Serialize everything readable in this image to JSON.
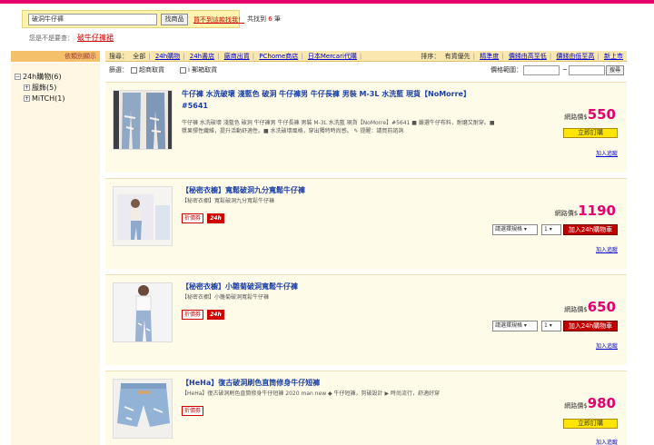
{
  "search": {
    "value": "破洞牛仔褲",
    "button": "找商品",
    "not_found": "買不到這款找我！"
  },
  "result": {
    "prefix": "共找到",
    "count": "6",
    "suffix": "筆"
  },
  "did_you_mean": {
    "label": "您是不是要查：",
    "suggestion": "破牛仔褲裙"
  },
  "sidebar": {
    "header": "依類別顯示",
    "items": [
      {
        "label": "24h購物(6)",
        "toggle": "−"
      },
      {
        "label": "服飾(5)",
        "toggle": "+"
      },
      {
        "label": "MiTCH(1)",
        "toggle": "+"
      }
    ]
  },
  "tabs": {
    "label": "搜尋：",
    "items": [
      "全部",
      "24h購物",
      "24h書店",
      "廠商出貨",
      "PChome商店",
      "日本Mercari代購"
    ]
  },
  "sort": {
    "label": "排序：",
    "items": [
      "有貨優先",
      "精準度",
      "價錢由高至低",
      "價錢由低至高",
      "新上市"
    ]
  },
  "filter": {
    "label": "篩選：",
    "option1": "超商取貨",
    "option2": "i 郵箱取貨",
    "price_range_label": "價格範圍：",
    "dash": "~",
    "go": "搜尋"
  },
  "products": [
    {
      "title": "牛仔褲 水洗破壞 淺藍色 破洞 牛仔褲男 牛仔長褲 男裝 M-3L 水洗藍 現貨【NoMorre】#5641",
      "desc": "牛仔褲 水洗破壞 淺藍色 破洞 牛仔褲男 牛仔長褲 男裝 M-3L 水洗藍 現貨【NoMorre】#5641 ■ 嚴選牛仔布料，耐磨又耐穿。■ 漿果彈性纖維，提升活動舒適性。■ 水洗破壞風格，穿出獨特時尚感。 ✎ 提醒：請買前諮詢",
      "price_label": "網路價$",
      "price": "550",
      "action": "立即訂購",
      "track": "加入追蹤"
    },
    {
      "title": "【秘密衣櫥】寬鬆破洞九分寬鬆牛仔褲",
      "desc": "【秘密衣櫥】寬鬆破洞九分寬鬆牛仔褲",
      "coupon": "折價券",
      "badge": "24h",
      "spec": "請選擇規格",
      "qty": "1",
      "price_label": "網路價$",
      "price": "1190",
      "action": "加入24h購物車",
      "track": "加入追蹤"
    },
    {
      "title": "【秘密衣櫥】小雛菊破洞寬鬆牛仔褲",
      "desc": "【秘密衣櫥】小雛菊破洞寬鬆牛仔褲",
      "coupon": "折價券",
      "badge": "24h",
      "spec": "請選擇規格",
      "qty": "1",
      "price_label": "網路價$",
      "price": "650",
      "action": "加入24h購物車",
      "track": "加入追蹤"
    },
    {
      "title": "【HeHa】復古破洞刷色直筒修身牛仔短褲",
      "desc": "【HeHa】復古破洞刷色直筒修身牛仔短褲 2020 man new ◆ 牛仔短褲，剪破設計 ▶ 時尚流行，舒適好穿",
      "coupon": "折價券",
      "price_label": "網路價$",
      "price": "980",
      "action": "立即訂購",
      "track": "加入追蹤"
    }
  ],
  "colors": {
    "brand": "#e4006d",
    "link": "#1a3fa8",
    "price": "#e4006d",
    "buy": "#ffe600",
    "cart": "#c00000"
  }
}
